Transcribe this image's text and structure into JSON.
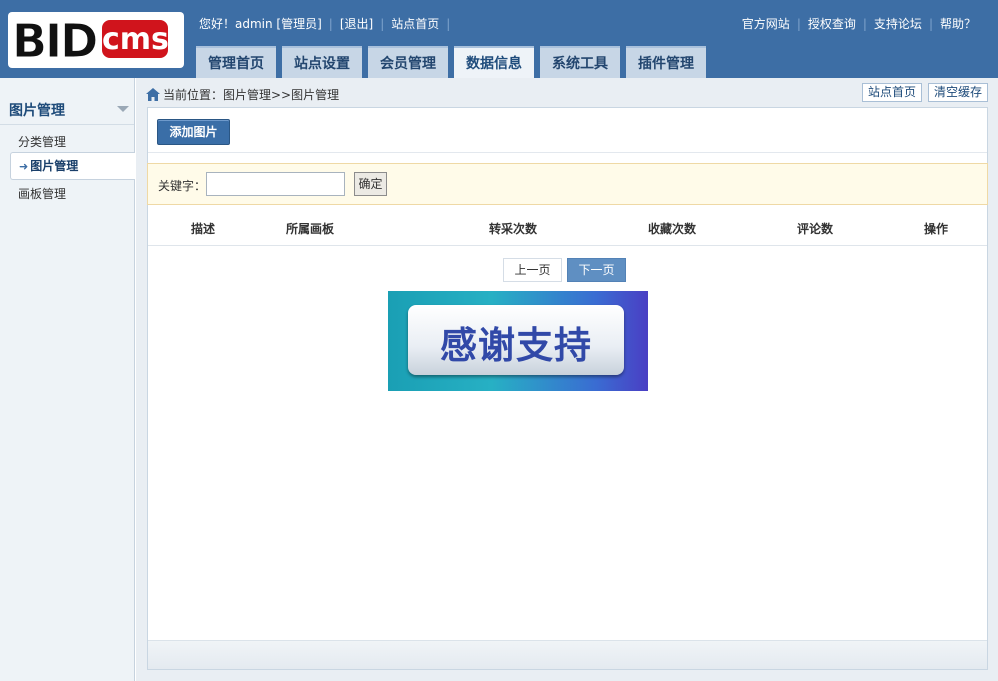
{
  "logo": {
    "part1": "BID",
    "part2": "cms",
    "part3": ".com"
  },
  "topbar": {
    "greeting": "您好！admin [管理员]",
    "logout": "[退出]",
    "site_home": "站点首页",
    "links": [
      "官方网站",
      "授权查询",
      "支持论坛",
      "帮助？"
    ]
  },
  "nav": {
    "tabs": [
      "管理首页",
      "站点设置",
      "会员管理",
      "数据信息",
      "系统工具",
      "插件管理"
    ],
    "active": "数据信息"
  },
  "sidebar": {
    "title": "图片管理",
    "items": [
      "分类管理",
      "图片管理",
      "画板管理"
    ]
  },
  "breadcrumb": {
    "text": "当前位置：图片管理>>图片管理"
  },
  "top_buttons": [
    "站点首页",
    "清空缓存"
  ],
  "main": {
    "add_button": "添加图片",
    "search": {
      "label": "关键字：",
      "value": "",
      "button": "确定"
    },
    "columns": [
      "描述",
      "所属画板",
      "转采次数",
      "收藏次数",
      "评论数",
      "操作"
    ],
    "pager": {
      "prev": "上一页",
      "next": "下一页"
    },
    "thanks_image_text": "感谢支持"
  },
  "colors": {
    "header": "#3d6ea5",
    "accent": "#3a6ea7",
    "logo_red": "#d0141c"
  }
}
